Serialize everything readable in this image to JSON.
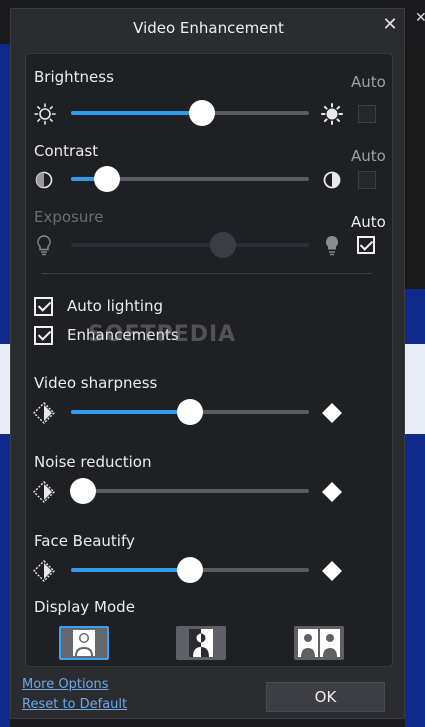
{
  "dialog": {
    "title": "Video Enhancement",
    "ok_label": "OK",
    "more_options": "More Options",
    "reset_default": "Reset to Default"
  },
  "sliders": {
    "brightness": {
      "label": "Brightness",
      "auto_label": "Auto",
      "auto_checked": false,
      "value": 0.55,
      "enabled": true
    },
    "contrast": {
      "label": "Contrast",
      "auto_label": "Auto",
      "auto_checked": false,
      "value": 0.15,
      "enabled": true
    },
    "exposure": {
      "label": "Exposure",
      "auto_label": "Auto",
      "auto_checked": true,
      "value": 0.64,
      "enabled": false
    },
    "sharpness": {
      "label": "Video sharpness",
      "value": 0.5
    },
    "noise": {
      "label": "Noise reduction",
      "value": 0.05
    },
    "beautify": {
      "label": "Face Beautify",
      "value": 0.5
    }
  },
  "checkboxes": {
    "auto_lighting": {
      "label": "Auto lighting",
      "checked": true
    },
    "enhancements": {
      "label": "Enhancements",
      "checked": true
    }
  },
  "watermark": "SOFTPEDIA",
  "display_mode": {
    "label": "Display Mode",
    "options": [
      "single-person",
      "split-person",
      "two-person"
    ],
    "selected": 0
  },
  "colors": {
    "accent": "#2f9cf0",
    "active_border": "#3aa2ee",
    "link": "#6ea8e8"
  }
}
